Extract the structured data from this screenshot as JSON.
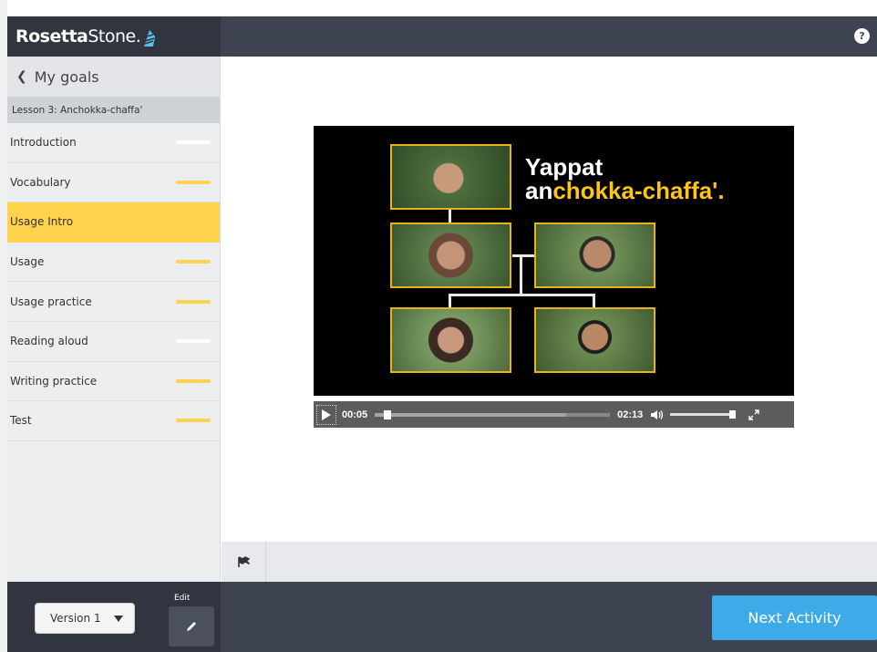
{
  "header": {
    "logo_bold": "Rosetta",
    "logo_light": "Stone.",
    "help_label": "?"
  },
  "sidebar": {
    "back_label": "My goals",
    "lesson_title": "Lesson 3: Anchokka-chaffa'",
    "steps": [
      {
        "label": "Introduction",
        "bar": "white"
      },
      {
        "label": "Vocabulary",
        "bar": "yellow"
      },
      {
        "label": "Usage Intro",
        "bar": "none",
        "active": true
      },
      {
        "label": "Usage",
        "bar": "yellow"
      },
      {
        "label": "Usage practice",
        "bar": "yellow"
      },
      {
        "label": "Reading aloud",
        "bar": "white"
      },
      {
        "label": "Writing practice",
        "bar": "yellow"
      },
      {
        "label": "Test",
        "bar": "yellow"
      }
    ]
  },
  "video": {
    "title_line1": "Yappat",
    "title_line2_white": "an",
    "title_line2_yellow": "chokka-chaffa'.",
    "current_time": "00:05",
    "total_time": "02:13",
    "progress_fraction": 0.04,
    "volume_fraction": 1.0
  },
  "footer": {
    "version_label": "Version 1",
    "edit_label": "Edit",
    "next_label": "Next Activity"
  },
  "colors": {
    "accent_yellow": "#ffd34e",
    "next_button": "#3eabe9",
    "header_bg": "#3d4350"
  },
  "icons": {
    "back": "chevron-left-icon",
    "help": "question-icon",
    "edit": "pencil-icon",
    "flag": "flag-icon",
    "play": "play-icon",
    "volume": "volume-icon",
    "fullscreen": "fullscreen-icon"
  }
}
